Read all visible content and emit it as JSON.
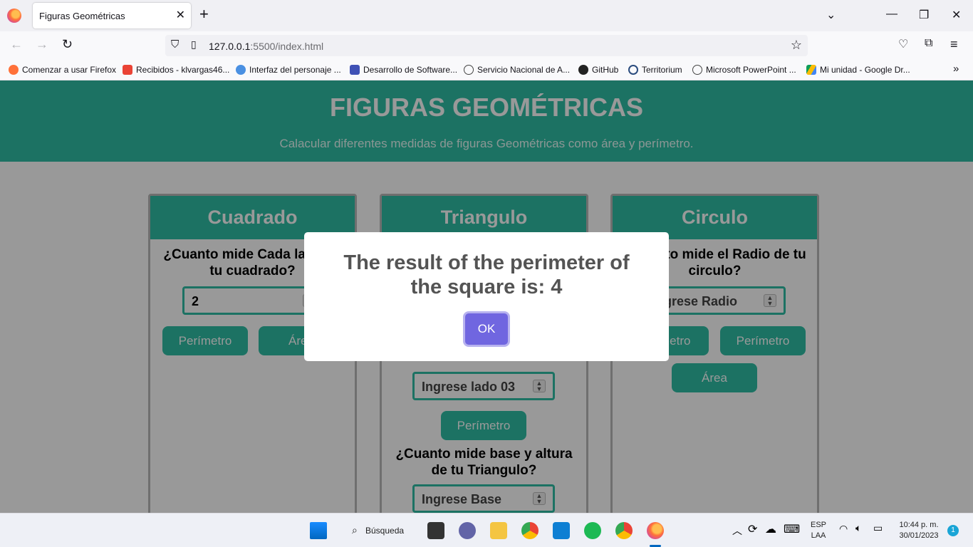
{
  "browser": {
    "tab_title": "Figuras Geométricas",
    "url_host": "127.0.0.1",
    "url_rest": ":5500/index.html",
    "bookmarks": [
      "Comenzar a usar Firefox",
      "Recibidos - klvargas46...",
      "Interfaz del personaje ...",
      "Desarrollo de Software...",
      "Servicio Nacional de A...",
      "GitHub",
      "Territorium",
      "Microsoft PowerPoint ...",
      "Mi unidad - Google Dr..."
    ]
  },
  "page": {
    "title": "FIGURAS GEOMÉTRICAS",
    "subtitle": "Calacular diferentes medidas de figuras Geométricas como área y perímetro.",
    "square": {
      "heading": "Cuadrado",
      "question": "¿Cuanto mide Cada lado de tu cuadrado?",
      "input_value": "2",
      "btn_perimeter": "Perímetro",
      "btn_area": "Área"
    },
    "triangle": {
      "heading": "Triangulo",
      "side3_placeholder": "Ingrese lado 03",
      "btn_perimeter": "Perímetro",
      "question_base": "¿Cuanto mide base y altura de tu Triangulo?",
      "base_placeholder": "Ingrese Base"
    },
    "circle": {
      "heading": "Circulo",
      "question": "¿Cuanto mide el Radio de tu circulo?",
      "radius_placeholder": "Ingrese Radio",
      "btn_diameter": "Diámetro",
      "btn_perimeter": "Perímetro",
      "btn_area": "Área"
    }
  },
  "modal": {
    "message": "The result of the perimeter of the square is: 4",
    "ok_label": "OK"
  },
  "taskbar": {
    "search_label": "Búsqueda",
    "lang": "ESP",
    "layout": "LAA",
    "time": "10:44 p. m.",
    "date": "30/01/2023",
    "notifications": "1"
  },
  "colors": {
    "accent": "#2fbfa6",
    "ok_button": "#7066e0"
  }
}
